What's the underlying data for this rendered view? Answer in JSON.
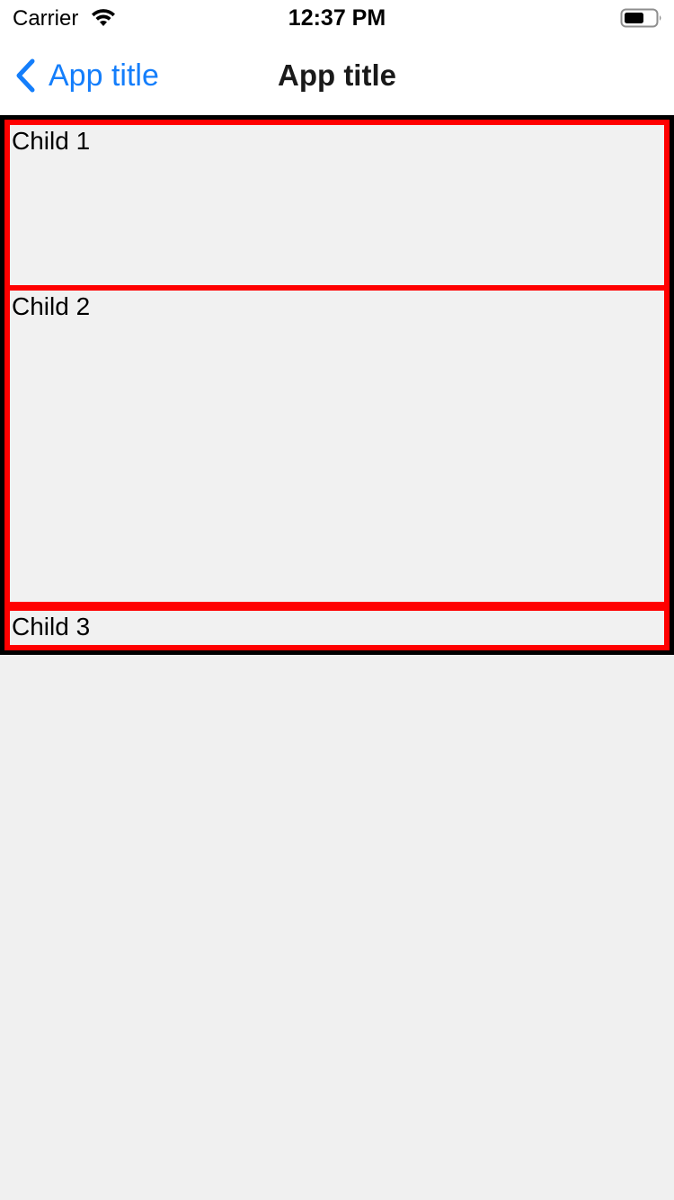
{
  "status_bar": {
    "carrier": "Carrier",
    "time": "12:37 PM",
    "icons": [
      "wifi-icon",
      "battery-icon"
    ]
  },
  "nav_bar": {
    "back_label": "App title",
    "title": "App title",
    "back_icon": "chevron-left-icon",
    "accent_color": "#147efb"
  },
  "content": {
    "children": [
      {
        "label": "Child 1"
      },
      {
        "label": "Child 2"
      },
      {
        "label": "Child 3"
      }
    ],
    "container_border_color": "#000000",
    "child_border_color": "#ff0000",
    "background_color": "#f0f0f0"
  }
}
